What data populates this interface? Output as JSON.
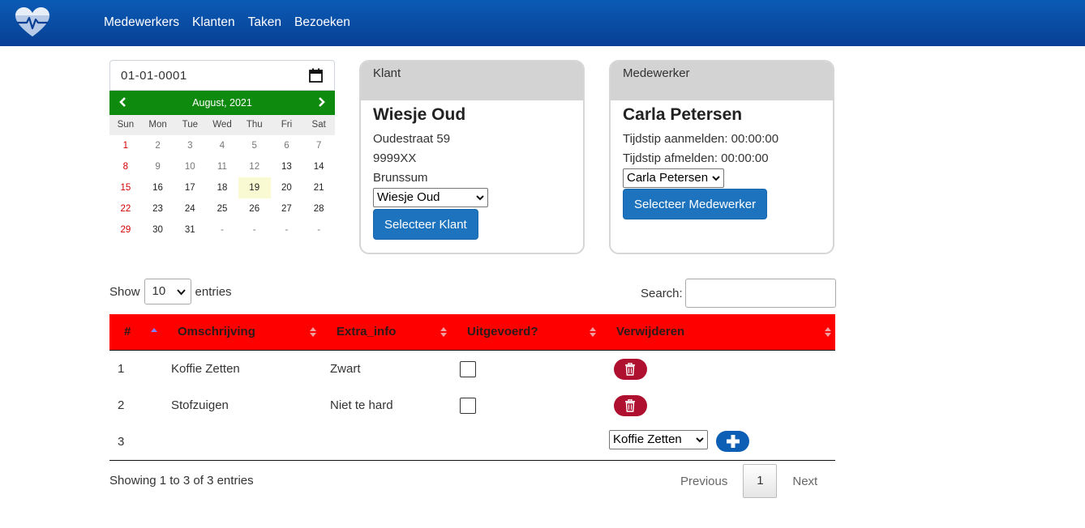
{
  "nav": {
    "items": [
      "Medewerkers",
      "Klanten",
      "Taken",
      "Bezoeken"
    ]
  },
  "date_input": {
    "value": "01-01-0001"
  },
  "calendar": {
    "month_label": "August, 2021",
    "weekdays": [
      "Sun",
      "Mon",
      "Tue",
      "Wed",
      "Thu",
      "Fri",
      "Sat"
    ],
    "today": "19",
    "weeks": [
      [
        "1",
        "2",
        "3",
        "4",
        "5",
        "6",
        "7"
      ],
      [
        "8",
        "9",
        "10",
        "11",
        "12",
        "13",
        "14"
      ],
      [
        "15",
        "16",
        "17",
        "18",
        "19",
        "20",
        "21"
      ],
      [
        "22",
        "23",
        "24",
        "25",
        "26",
        "27",
        "28"
      ],
      [
        "29",
        "30",
        "31",
        "-",
        "-",
        "-",
        "-"
      ]
    ]
  },
  "klant_card": {
    "header": "Klant",
    "name": "Wiesje Oud",
    "address": "Oudestraat 59",
    "postcode": "9999XX",
    "city": "Brunssum",
    "select_value": "Wiesje Oud",
    "button": "Selecteer Klant"
  },
  "medewerker_card": {
    "header": "Medewerker",
    "name": "Carla Petersen",
    "login": "Tijdstip aanmelden: 00:00:00",
    "logout": "Tijdstip afmelden: 00:00:00",
    "select_value": "Carla Petersen",
    "button": "Selecteer Medewerker"
  },
  "table_controls": {
    "show_label": "Show",
    "length_value": "10",
    "entries_label": "entries",
    "search_label": "Search:"
  },
  "table": {
    "headers": [
      "#",
      "Omschrijving",
      "Extra_info",
      "Uitgevoerd?",
      "Verwijderen"
    ],
    "rows": [
      {
        "num": "1",
        "omschrijving": "Koffie Zetten",
        "extra": "Zwart",
        "done": false
      },
      {
        "num": "2",
        "omschrijving": "Stofzuigen",
        "extra": "Niet te hard",
        "done": false
      }
    ],
    "new_row": {
      "num": "3",
      "select_value": "Koffie Zetten"
    }
  },
  "footer": {
    "info": "Showing 1 to 3 of 3 entries",
    "prev": "Previous",
    "page": "1",
    "next": "Next"
  },
  "colors": {
    "navbar": "#083f94",
    "calendar_header": "#0e8a0e",
    "table_header": "#ff0000",
    "primary_button": "#1e73be",
    "delete_button": "#b0102f"
  }
}
